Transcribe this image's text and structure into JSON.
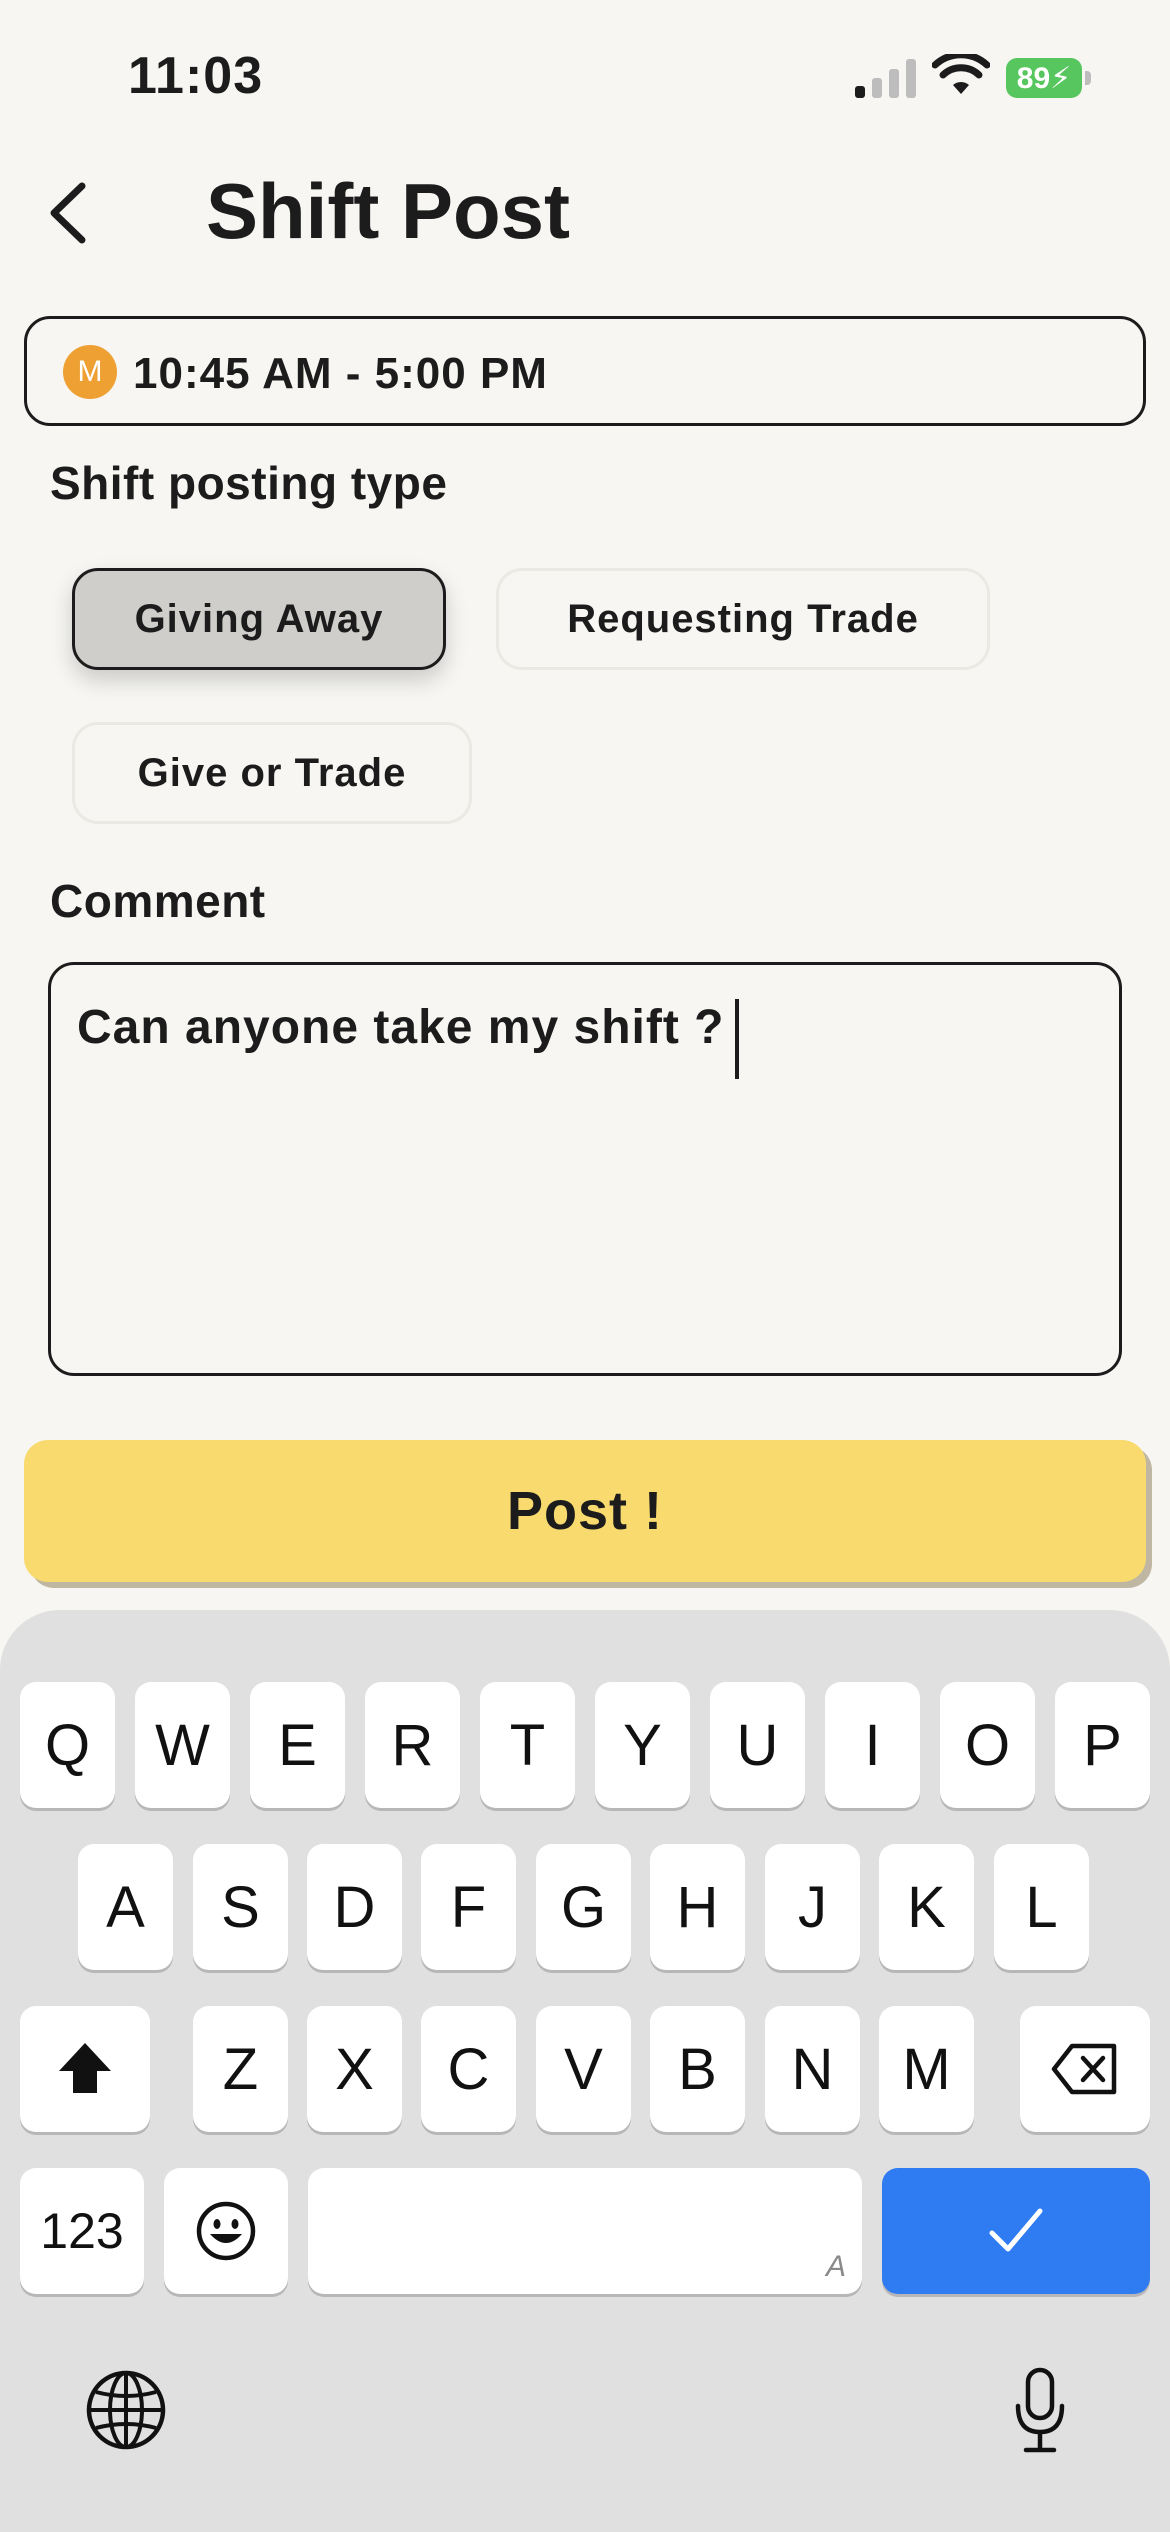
{
  "status_bar": {
    "time": "11:03",
    "battery": "89"
  },
  "header": {
    "title": "Shift Post",
    "back_icon": "chevron-left-icon"
  },
  "shift": {
    "avatar_letter": "M",
    "time_range": "10:45 AM - 5:00 PM",
    "avatar_color": "#eea033"
  },
  "posting_type": {
    "label": "Shift posting type",
    "options": [
      "Giving Away",
      "Requesting Trade",
      "Give or Trade"
    ],
    "selected": "Giving Away"
  },
  "comment": {
    "label": "Comment",
    "value": "Can anyone take my shift ?"
  },
  "post_button": {
    "label": "Post !",
    "color": "#f8da6e"
  },
  "keyboard": {
    "row1": [
      "Q",
      "W",
      "E",
      "R",
      "T",
      "Y",
      "U",
      "I",
      "O",
      "P"
    ],
    "row2": [
      "A",
      "S",
      "D",
      "F",
      "G",
      "H",
      "J",
      "K",
      "L"
    ],
    "row3": [
      "Z",
      "X",
      "C",
      "V",
      "B",
      "N",
      "M"
    ],
    "numbers_key": "123",
    "space_hint": "A",
    "done_color": "#2f7bf2"
  }
}
